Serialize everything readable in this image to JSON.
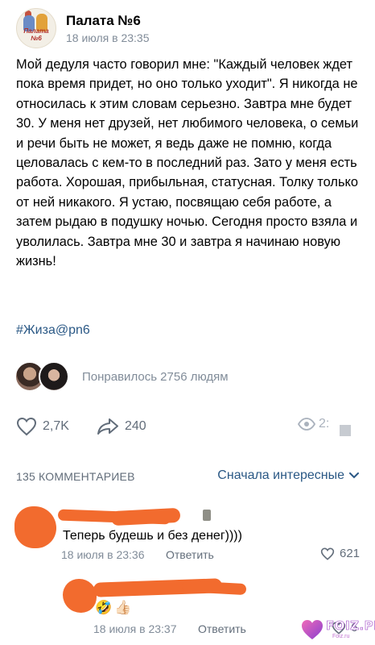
{
  "post": {
    "group_name": "Палата №6",
    "avatar_caption": "Палата №6",
    "time": "18 июля в 23:35",
    "text": "Мой дедуля часто говорил мне: \"Каждый человек ждет пока время придет, но оно только уходит\". Я никогда не относилась к этим словам серьезно. Завтра мне будет 30. У меня нет друзей, нет любимого человека, о семьи и речи быть не может, я ведь даже не помню, когда целовалась с кем-то в последний раз. Зато у меня есть работа. Хорошая, прибыльная, статусная. Толку только от ней никакого. Я устаю, посвящаю себя работе, а затем рыдаю в подушку ночью. Сегодня просто взяла и уволилась. Завтра мне 30 и завтра я начинаю новую жизнь!",
    "hashtag": "#Жиза@pn6",
    "liked_by": "Понравилось 2756 людям"
  },
  "actions": {
    "likes": "2,7K",
    "shares": "240",
    "views": "2:"
  },
  "comments_header": {
    "count": "135 КОММЕНТАРИЕВ",
    "sort": "Сначала интересные"
  },
  "comments": [
    {
      "text": "Теперь будешь и без денег))))",
      "time": "18 июля в 23:36",
      "reply": "Ответить",
      "likes": "621"
    },
    {
      "emoji": [
        "🤣",
        "👍🏻"
      ],
      "time": "18 июля в 23:37",
      "reply": "Ответить",
      "likes": "6"
    }
  ],
  "watermark": {
    "text": "FOIZ.PRO",
    "sub": "Foiz.ru"
  },
  "colors": {
    "link": "#2a5885",
    "meta": "#818c99",
    "icon": "#626d7a",
    "scribble": "#f26b2e"
  }
}
